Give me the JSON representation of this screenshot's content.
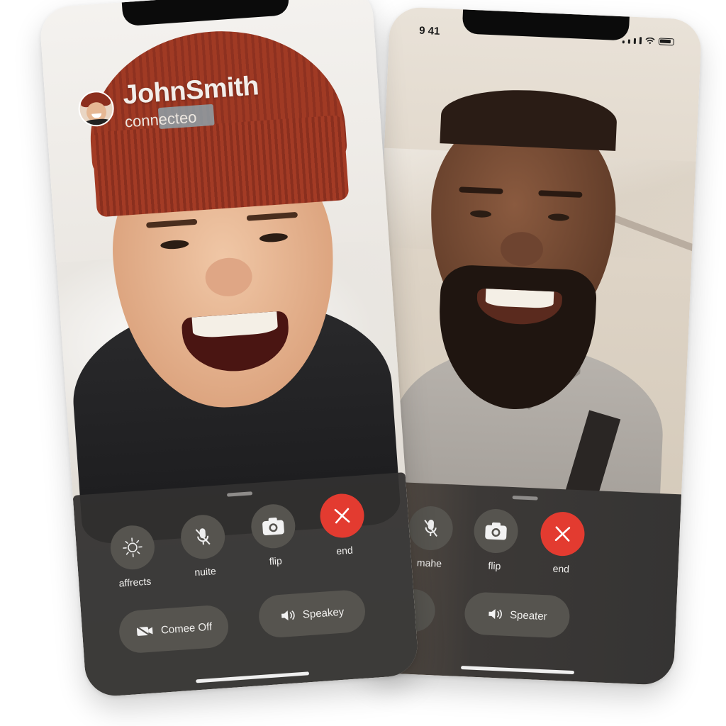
{
  "front_phone": {
    "caller": {
      "name": "JohnSmith",
      "status": "connecteo"
    },
    "controls": [
      {
        "label": "affrects",
        "icon": "sparkle-effects-icon"
      },
      {
        "label": "nuite",
        "icon": "mic-muted-icon"
      },
      {
        "label": "flip",
        "icon": "camera-flip-icon"
      },
      {
        "label": "end",
        "icon": "close-x-icon"
      }
    ],
    "pills": [
      {
        "label": "Comee Off",
        "icon": "camera-off-icon"
      },
      {
        "label": "Speakey",
        "icon": "speaker-icon"
      }
    ]
  },
  "back_phone": {
    "status_bar": {
      "time": "9 41"
    },
    "controls": [
      {
        "label": "mahe",
        "icon": "mic-muted-icon"
      },
      {
        "label": "flip",
        "icon": "camera-flip-icon"
      },
      {
        "label": "end",
        "icon": "close-x-icon"
      }
    ],
    "pills": [
      {
        "label": "",
        "icon": "camera-off-icon"
      },
      {
        "label": "Speater",
        "icon": "speaker-icon"
      }
    ]
  },
  "colors": {
    "end_button": "#e33b30",
    "panel": "#323130",
    "control": "#56544f"
  }
}
